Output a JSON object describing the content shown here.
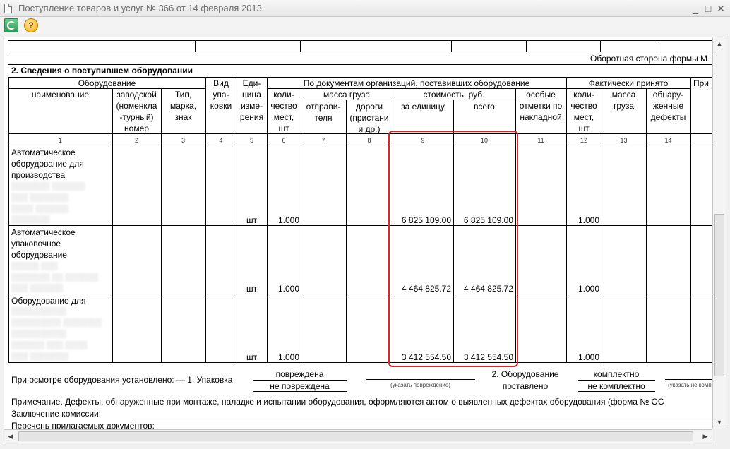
{
  "window": {
    "title": "Поступление товаров и услуг № 366 от 14 февраля 2013",
    "minimize": "_",
    "maximize": "□",
    "close": "✕"
  },
  "toolbar": {
    "help": "?"
  },
  "form": {
    "reverse_side": "Оборотная сторона формы М",
    "section_title": "2. Сведения о поступившем оборудовании",
    "headers": {
      "equipment": "Оборудование",
      "name": "наименование",
      "factory": [
        "заводской",
        "(номенкла",
        "-турный)",
        "номер"
      ],
      "type": [
        "Тип,",
        "марка,",
        "знак"
      ],
      "pack": [
        "Вид",
        "упа-",
        "ковки"
      ],
      "unit": [
        "Еди-",
        "ница",
        "изме-",
        "рения"
      ],
      "docs": "По документам организаций, поставивших оборудование",
      "qty": [
        "коли-",
        "чество",
        "мест,",
        "шт"
      ],
      "mass": "масса груза",
      "sender": [
        "отправи-",
        "теля"
      ],
      "road": [
        "дороги",
        "(пристани",
        "и др.)"
      ],
      "cost": "стоимость, руб.",
      "per_unit": "за единицу",
      "total": "всего",
      "notes": [
        "особые",
        "отметки по",
        "накладной"
      ],
      "actual": "Фактически принято",
      "act_qty": [
        "коли-",
        "чество",
        "мест,",
        "шт"
      ],
      "act_mass": [
        "масса",
        "груза"
      ],
      "defects": [
        "обнару-",
        "женные",
        "дефекты"
      ],
      "more": "При"
    },
    "col_numbers": [
      "1",
      "2",
      "3",
      "4",
      "5",
      "6",
      "7",
      "8",
      "9",
      "10",
      "11",
      "12",
      "13",
      "14"
    ],
    "rows": [
      {
        "name": [
          "Автоматическое",
          "оборудование для",
          "производства"
        ],
        "unit": "шт",
        "qty": "1.000",
        "price": "6 825 109.00",
        "total": "6 825 109.00",
        "act_qty": "1.000"
      },
      {
        "name": [
          "Автоматическое",
          "упаковочное",
          "оборудование"
        ],
        "unit": "шт",
        "qty": "1.000",
        "price": "4 464 825.72",
        "total": "4 464 825.72",
        "act_qty": "1.000"
      },
      {
        "name": [
          "Оборудование для"
        ],
        "unit": "шт",
        "qty": "1.000",
        "price": "3 412 554.50",
        "total": "3 412 554.50",
        "act_qty": "1.000"
      }
    ],
    "inspection": {
      "label": "При осмотре оборудования установлено: — 1. Упаковка",
      "damaged": "повреждена",
      "not_damaged": "не повреждена",
      "specify": "(указать повреждение)",
      "delivered_1": "2. Оборудование",
      "delivered_2": "поставлено",
      "complete": "комплектно",
      "not_complete": "не комплектно",
      "specify2": "(указать не комп"
    },
    "note": "Примечание. Дефекты, обнаруженные при монтаже, наладке и испытании оборудования, оформляются актом о выявленных дефектах оборудования (форма № ОС",
    "conclusion": "Заключение комиссии:",
    "attachments": "Перечень прилагаемых документов:"
  }
}
